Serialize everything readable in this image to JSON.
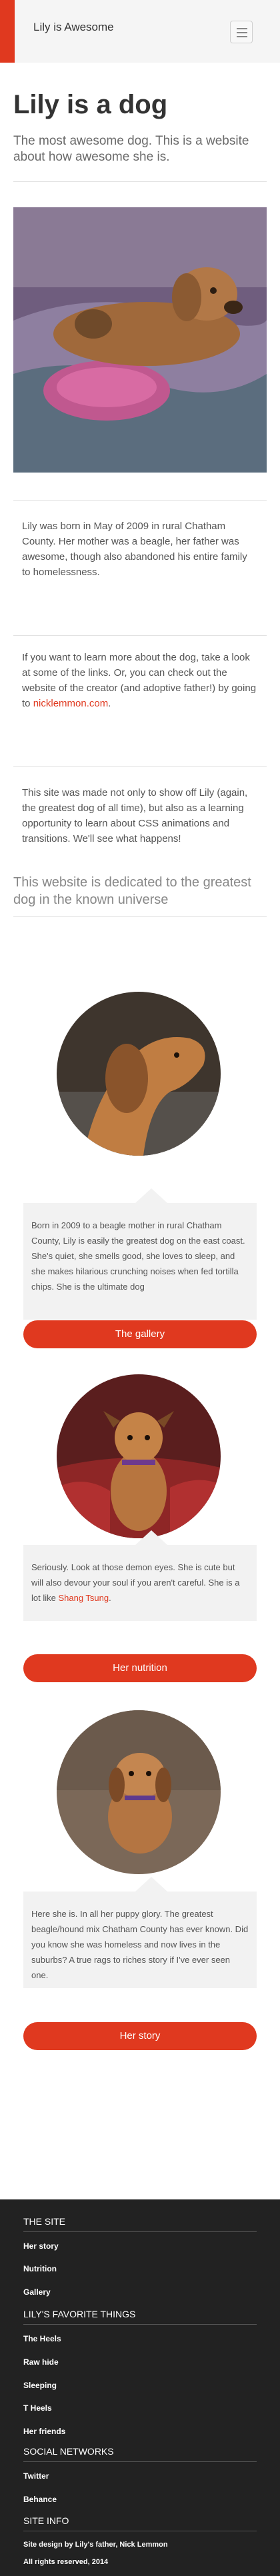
{
  "header": {
    "brand": "Lily is Awesome",
    "menu_icon": "hamburger-icon"
  },
  "hero": {
    "title": "Lily is a dog",
    "subtitle": "The most awesome dog. This is a website about how awesome she is."
  },
  "intro": {
    "p1": "Lily was born in May of 2009 in rural Chatham County. Her mother was a beagle, her father was awesome, though also abandoned his entire family to homelessness.",
    "p2_before": "If you want to learn more about the dog, take a look at some of the links. Or, you can check out the website of the creator (and adoptive father!) by going to ",
    "p2_link": "nicklemmon.com",
    "p2_after": ".",
    "p3": "This site was made not only to show off Lily (again, the greatest dog of all time), but also as a learning opportunity to learn about CSS animations and transitions. We'll see what happens!"
  },
  "dedicated": "This website is dedicated to the greatest dog in the known universe",
  "cards": [
    {
      "text": "Born in 2009 to a beagle mother in rural Chatham County, Lily is easily the greatest dog on the east coast. She's quiet, she smells good, she loves to sleep, and she makes hilarious crunching noises when fed tortilla chips. She is the ultimate dog",
      "button": "The gallery"
    },
    {
      "text_before": "Seriously. Look at those demon eyes. She is cute but will also devour your soul if you aren't careful. She is a lot like ",
      "text_link": "Shang Tsung",
      "text_after": ".",
      "button": "Her nutrition"
    },
    {
      "text": "Here she is. In all her puppy glory. The greatest beagle/hound mix Chatham County has ever known. Did you know she was homeless and now lives in the suburbs? A true rags to riches story if I've ever seen one.",
      "button": "Her story"
    }
  ],
  "footer": {
    "site_heading": "THE SITE",
    "site_links": [
      "Her story",
      "Nutrition",
      "Gallery"
    ],
    "favorites_heading": "LILY'S FAVORITE THINGS",
    "favorites_links": [
      "The Heels",
      "Raw hide",
      "Sleeping",
      "T Heels",
      "Her friends"
    ],
    "social_heading": "SOCIAL NETWORKS",
    "social_links": [
      "Twitter",
      "Behance"
    ],
    "info_heading": "SITE INFO",
    "credit": "Site design by Lily's father, Nick Lemmon",
    "rights": "All rights reserved, 2014"
  },
  "colors": {
    "accent": "#e0391f",
    "footer_bg": "#222222",
    "card_bg": "#f2f2f2"
  }
}
